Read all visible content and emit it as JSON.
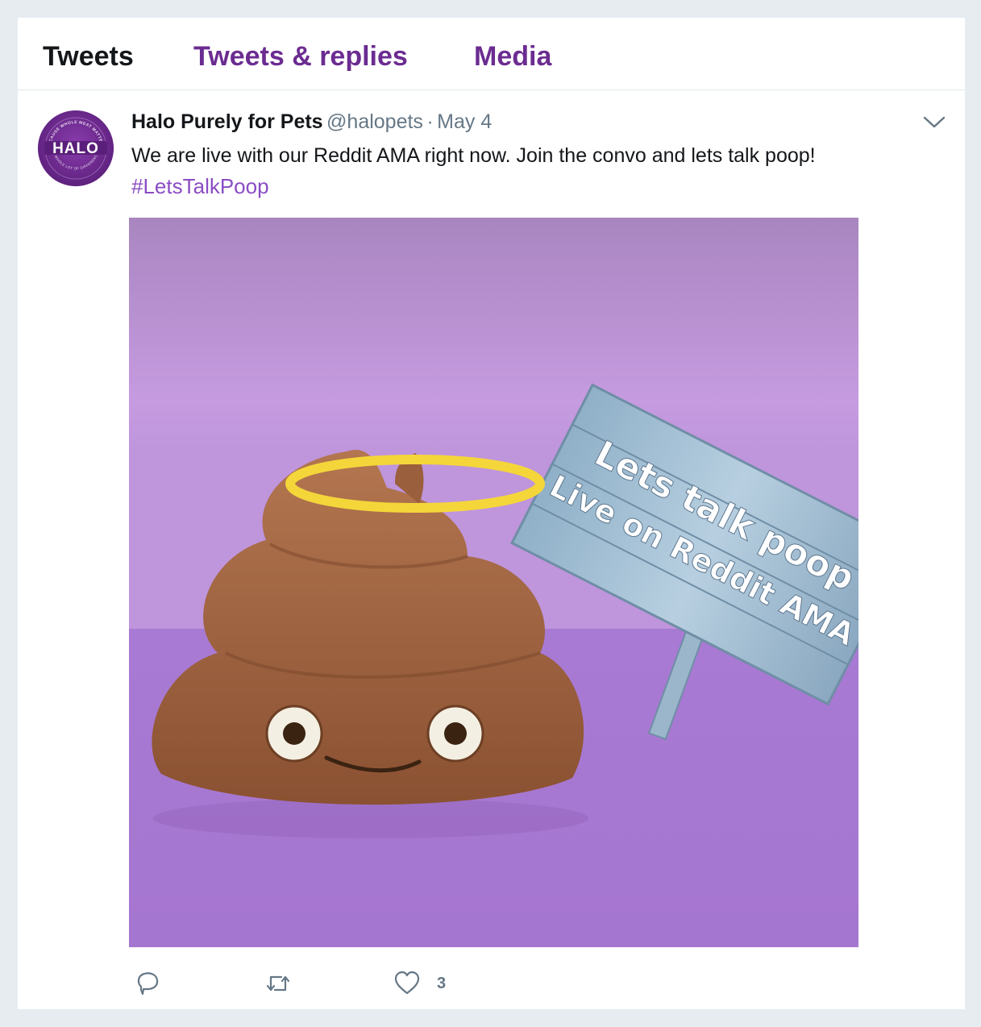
{
  "tabs": [
    {
      "label": "Tweets",
      "active": true
    },
    {
      "label": "Tweets & replies",
      "active": false
    },
    {
      "label": "Media",
      "active": false
    }
  ],
  "tweet": {
    "avatar": {
      "text": "HALO",
      "ring_text": "BECAUSE WHOLE MEAT MATTERS",
      "bottom_text": "A WHOLE LOT OF DIFFERENCE"
    },
    "author_name": "Halo Purely for Pets",
    "author_handle": "@halopets",
    "separator": "·",
    "date": "May 4",
    "text": "We are live with our Reddit AMA right now. Join the convo and lets talk poop!",
    "hashtag": "#LetsTalkPoop",
    "media": {
      "sign_line1": "Lets talk poop",
      "sign_line2": "Live on Reddit AMA",
      "background": "#b98ad6"
    },
    "actions": {
      "reply_icon": "reply-icon",
      "retweet_icon": "retweet-icon",
      "like_icon": "heart-icon",
      "like_count": "3"
    }
  },
  "colors": {
    "accent": "#6b2c91",
    "hashtag": "#8a4dc4",
    "secondary_text": "#657786",
    "page_bg": "#e6ecf0"
  }
}
